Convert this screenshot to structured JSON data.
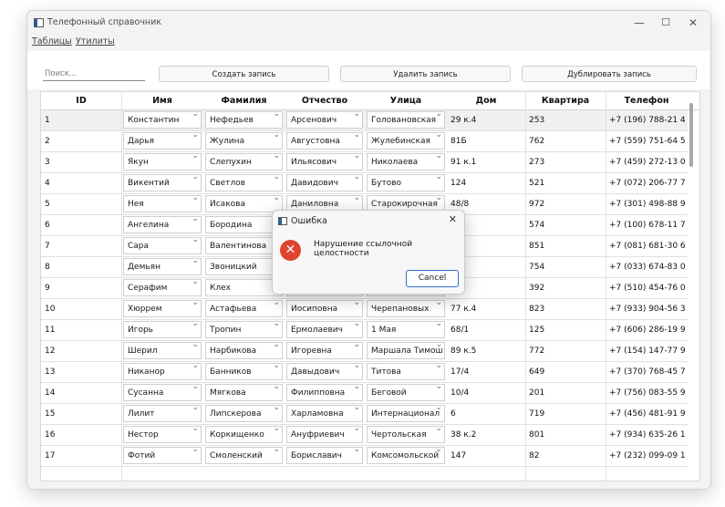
{
  "window": {
    "title": "Телефонный справочник"
  },
  "menu": [
    "Таблицы",
    "Утилиты"
  ],
  "toolbar": {
    "search_placeholder": "Поиск...",
    "create_label": "Создать запись",
    "delete_label": "Удалить запись",
    "duplicate_label": "Дублировать запись"
  },
  "table": {
    "headers": [
      "ID",
      "Имя",
      "Фамилия",
      "Отчество",
      "Улица",
      "Дом",
      "Квартира",
      "Телефон"
    ],
    "rows": [
      {
        "id": "1",
        "name": "Константин",
        "surname": "Нефедьев",
        "patronymic": "Арсенович",
        "street": "Голованoвская",
        "house": "29 к.4",
        "apt": "253",
        "phone": "+7 (196) 788-21 46"
      },
      {
        "id": "2",
        "name": "Дарья",
        "surname": "Жулина",
        "patronymic": "Августовна",
        "street": "Жулебинская",
        "house": "81Б",
        "apt": "762",
        "phone": "+7 (559) 751-64 52"
      },
      {
        "id": "3",
        "name": "Якун",
        "surname": "Слепухин",
        "patronymic": "Ильясович",
        "street": "Николаева",
        "house": "91 к.1",
        "apt": "273",
        "phone": "+7 (459) 272-13 09"
      },
      {
        "id": "4",
        "name": "Викентий",
        "surname": "Светлов",
        "patronymic": "Давидович",
        "street": "Бутово",
        "house": "124",
        "apt": "521",
        "phone": "+7 (072) 206-77 75"
      },
      {
        "id": "5",
        "name": "Нея",
        "surname": "Исакова",
        "patronymic": "Даниловна",
        "street": "Старокирочная",
        "house": "48/8",
        "apt": "972",
        "phone": "+7 (301) 498-88 96"
      },
      {
        "id": "6",
        "name": "Ангелина",
        "surname": "Бородина",
        "patronymic": "",
        "street": "",
        "house": "",
        "apt": "574",
        "phone": "+7 (100) 678-11 77"
      },
      {
        "id": "7",
        "name": "Сара",
        "surname": "Валентинова",
        "patronymic": "",
        "street": "",
        "house": "",
        "apt": "851",
        "phone": "+7 (081) 681-30 60"
      },
      {
        "id": "8",
        "name": "Демьян",
        "surname": "Звоницкий",
        "patronymic": "",
        "street": "",
        "house": "",
        "apt": "754",
        "phone": "+7 (033) 674-83 00"
      },
      {
        "id": "9",
        "name": "Серафим",
        "surname": "Клех",
        "patronymic": "",
        "street": "",
        "house": "",
        "apt": "392",
        "phone": "+7 (510) 454-76 06"
      },
      {
        "id": "10",
        "name": "Хюррем",
        "surname": "Астафьева",
        "patronymic": "Иосиповна",
        "street": "Черепановых",
        "house": "77 к.4",
        "apt": "823",
        "phone": "+7 (933) 904-56 38"
      },
      {
        "id": "11",
        "name": "Игорь",
        "surname": "Тропин",
        "patronymic": "Ермолаевич",
        "street": "1 Мая",
        "house": "68/1",
        "apt": "125",
        "phone": "+7 (606) 286-19 90"
      },
      {
        "id": "12",
        "name": "Шерил",
        "surname": "Нарбикова",
        "patronymic": "Игоревна",
        "street": "Маршала Тимош",
        "house": "89 к.5",
        "apt": "772",
        "phone": "+7 (154) 147-77 94"
      },
      {
        "id": "13",
        "name": "Никанор",
        "surname": "Банников",
        "patronymic": "Давыдович",
        "street": "Титова",
        "house": "17/4",
        "apt": "649",
        "phone": "+7 (370) 768-45 77"
      },
      {
        "id": "14",
        "name": "Сусанна",
        "surname": "Мягкова",
        "patronymic": "Филипповна",
        "street": "Беговой",
        "house": "10/4",
        "apt": "201",
        "phone": "+7 (756) 083-55 97"
      },
      {
        "id": "15",
        "name": "Лилит",
        "surname": "Липскерова",
        "patronymic": "Харламовна",
        "street": "Интернационал",
        "house": "6",
        "apt": "719",
        "phone": "+7 (456) 481-91 91"
      },
      {
        "id": "16",
        "name": "Нестор",
        "surname": "Коркищенко",
        "patronymic": "Ануфриевич",
        "street": "Чертольская",
        "house": "38 к.2",
        "apt": "801",
        "phone": "+7 (934) 635-26 10"
      },
      {
        "id": "17",
        "name": "Фотий",
        "surname": "Смоленский",
        "patronymic": "Бориславич",
        "street": "Комсомольской",
        "house": "147",
        "apt": "82",
        "phone": "+7 (232) 099-09 11"
      }
    ]
  },
  "dialog": {
    "title": "Ошибка",
    "message": "Нарушение ссылочной целостности",
    "button": "Cancel"
  }
}
